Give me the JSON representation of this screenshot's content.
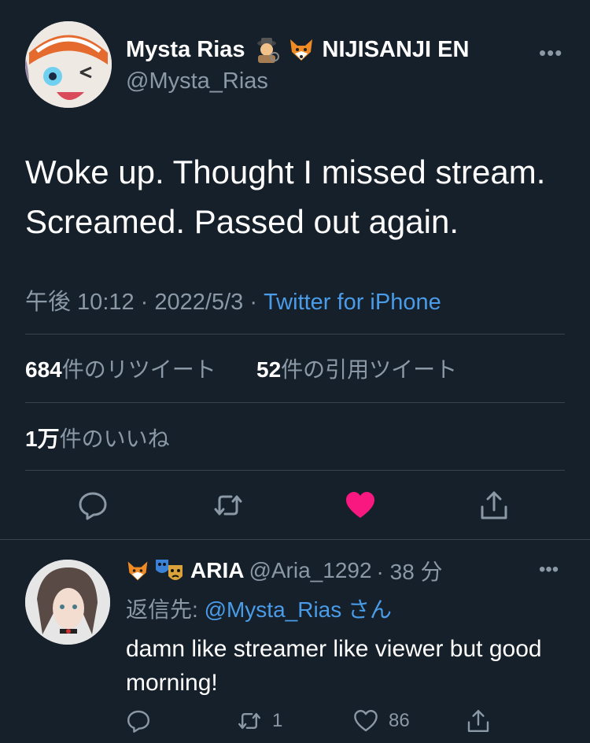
{
  "tweet": {
    "display_name": "Mysta Rias",
    "affiliation": "NIJISANJI EN",
    "handle": "@Mysta_Rias",
    "more_icon": "•••",
    "text_line1": "Woke up. Thought I missed stream.",
    "text_line2": "Screamed. Passed out again.",
    "time": "午後 10:12 · 2022/5/3 · ",
    "source": "Twitter for iPhone"
  },
  "stats": {
    "retweets_count": "684",
    "retweets_label": "件のリツイート",
    "quotes_count": "52",
    "quotes_label": "件の引用ツイート",
    "likes_count": "1万",
    "likes_label": "件のいいね"
  },
  "reply": {
    "display_name": "ARIA",
    "handle": "@Aria_1292",
    "time": "· 38 分",
    "reply_to_label": "返信先: ",
    "reply_to_handle": "@Mysta_Rias",
    "reply_to_suffix": " さん",
    "text": "damn like streamer like viewer but good morning!",
    "retweet_count": "1",
    "like_count": "86",
    "more_icon": "•••"
  },
  "colors": {
    "background": "#15202b",
    "muted": "#8b98a5",
    "link": "#4a9ce8",
    "like_active": "#f91880",
    "divider": "#38444d"
  }
}
